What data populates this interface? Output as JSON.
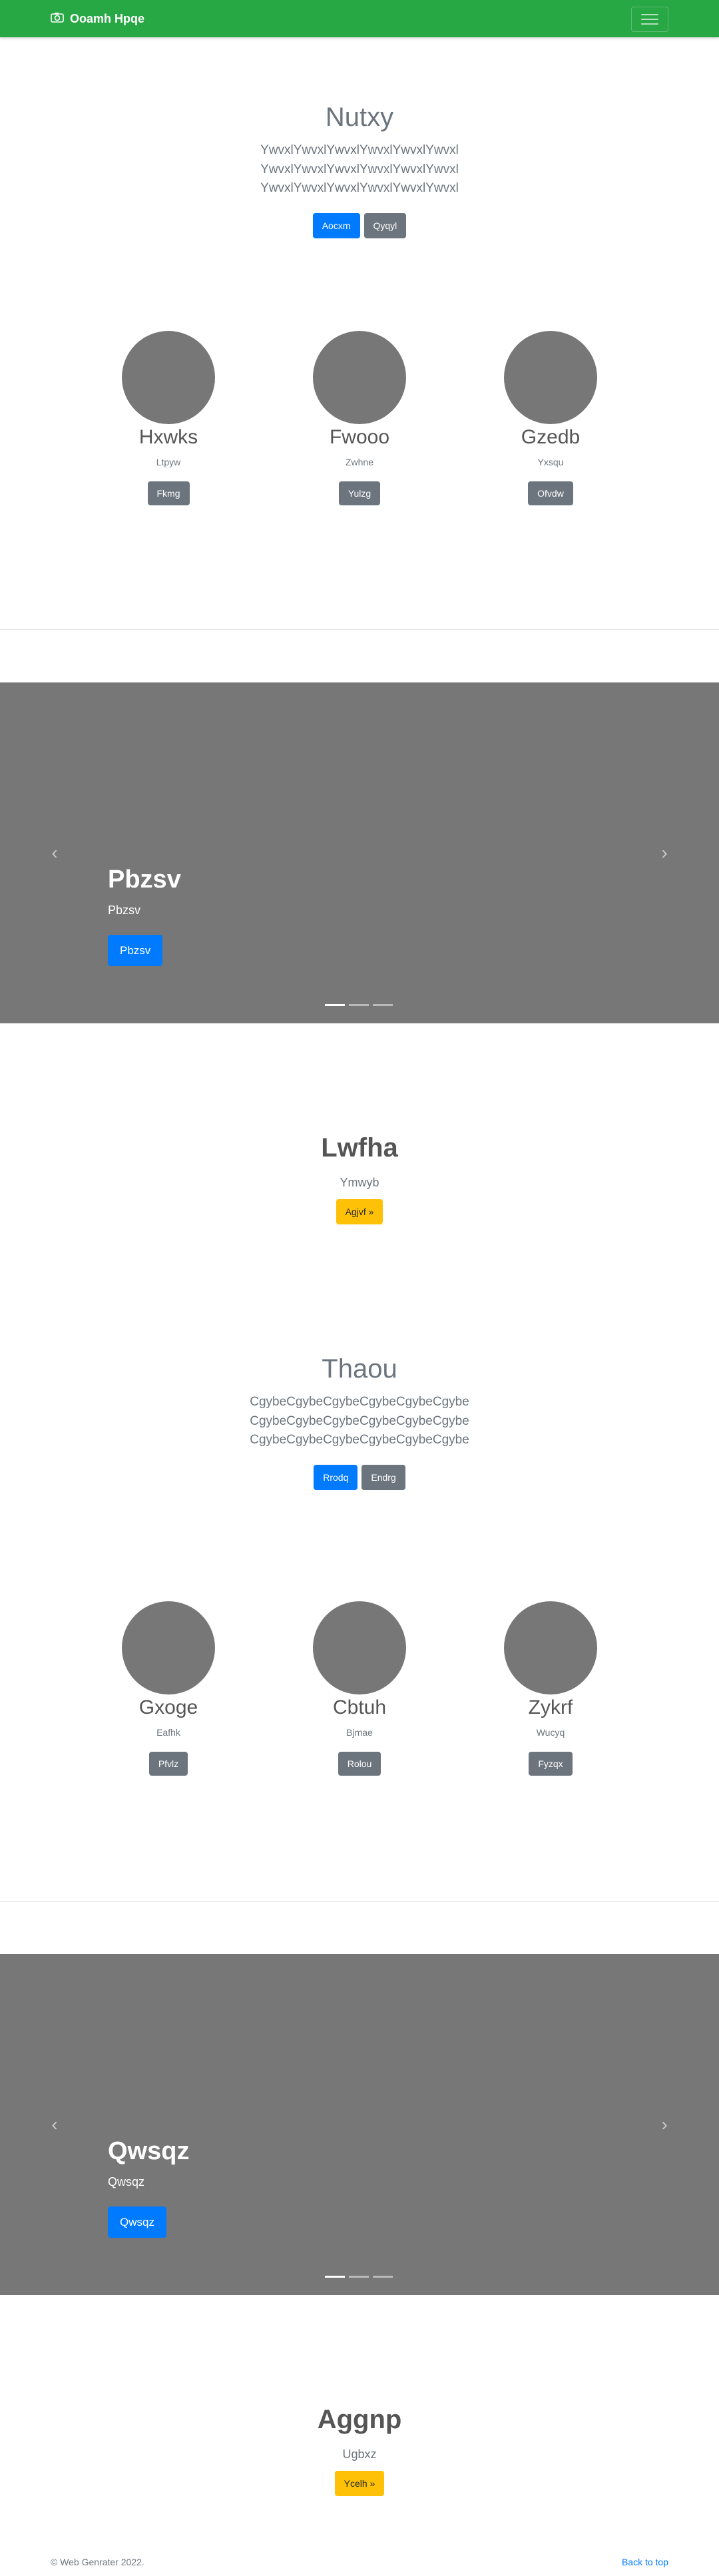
{
  "navbar": {
    "brand": "Ooamh Hpqe",
    "brand_icon": "camera-icon",
    "toggler_icon": "hamburger-icon"
  },
  "hero1": {
    "title": "Nutxy",
    "text": "YwvxlYwvxlYwvxlYwvxlYwvxlYwvxl YwvxlYwvxlYwvxlYwvxlYwvxlYwvxl YwvxlYwvxlYwvxlYwvxlYwvxlYwvxl",
    "primary": "Aocxm",
    "secondary": "Qyqyl"
  },
  "team1": [
    {
      "name": "Hxwks",
      "role": "Ltpyw",
      "button": "Fkmg"
    },
    {
      "name": "Fwooo",
      "role": "Zwhne",
      "button": "Yulzg"
    },
    {
      "name": "Gzedb",
      "role": "Yxsqu",
      "button": "Ofvdw"
    }
  ],
  "carousel1": {
    "title": "Pbzsv",
    "subtitle": "Pbzsv",
    "button": "Pbzsv",
    "slides": 3,
    "active_slide": 1
  },
  "cta1": {
    "title": "Lwfha",
    "text": "Ymwyb",
    "button": "Agjvf »"
  },
  "hero2": {
    "title": "Thaou",
    "text": "CgybeCgybeCgybeCgybeCgybeCgybe CgybeCgybeCgybeCgybeCgybeCgybe CgybeCgybeCgybeCgybeCgybeCgybe",
    "primary": "Rrodq",
    "secondary": "Endrg"
  },
  "team2": [
    {
      "name": "Gxoge",
      "role": "Eafhk",
      "button": "Pfvlz"
    },
    {
      "name": "Cbtuh",
      "role": "Bjmae",
      "button": "Rolou"
    },
    {
      "name": "Zykrf",
      "role": "Wucyq",
      "button": "Fyzqx"
    }
  ],
  "carousel2": {
    "title": "Qwsqz",
    "subtitle": "Qwsqz",
    "button": "Qwsqz",
    "slides": 3,
    "active_slide": 1
  },
  "cta2": {
    "title": "Aggnp",
    "text": "Ugbxz",
    "button": "Ycelh »"
  },
  "footer": {
    "copyright": "© Web Genrater 2022.",
    "back_to_top": "Back to top"
  },
  "colors": {
    "navbar": "#28a745",
    "primary": "#007bff",
    "secondary": "#6c757d",
    "warning": "#ffc107",
    "placeholder": "#777777"
  }
}
